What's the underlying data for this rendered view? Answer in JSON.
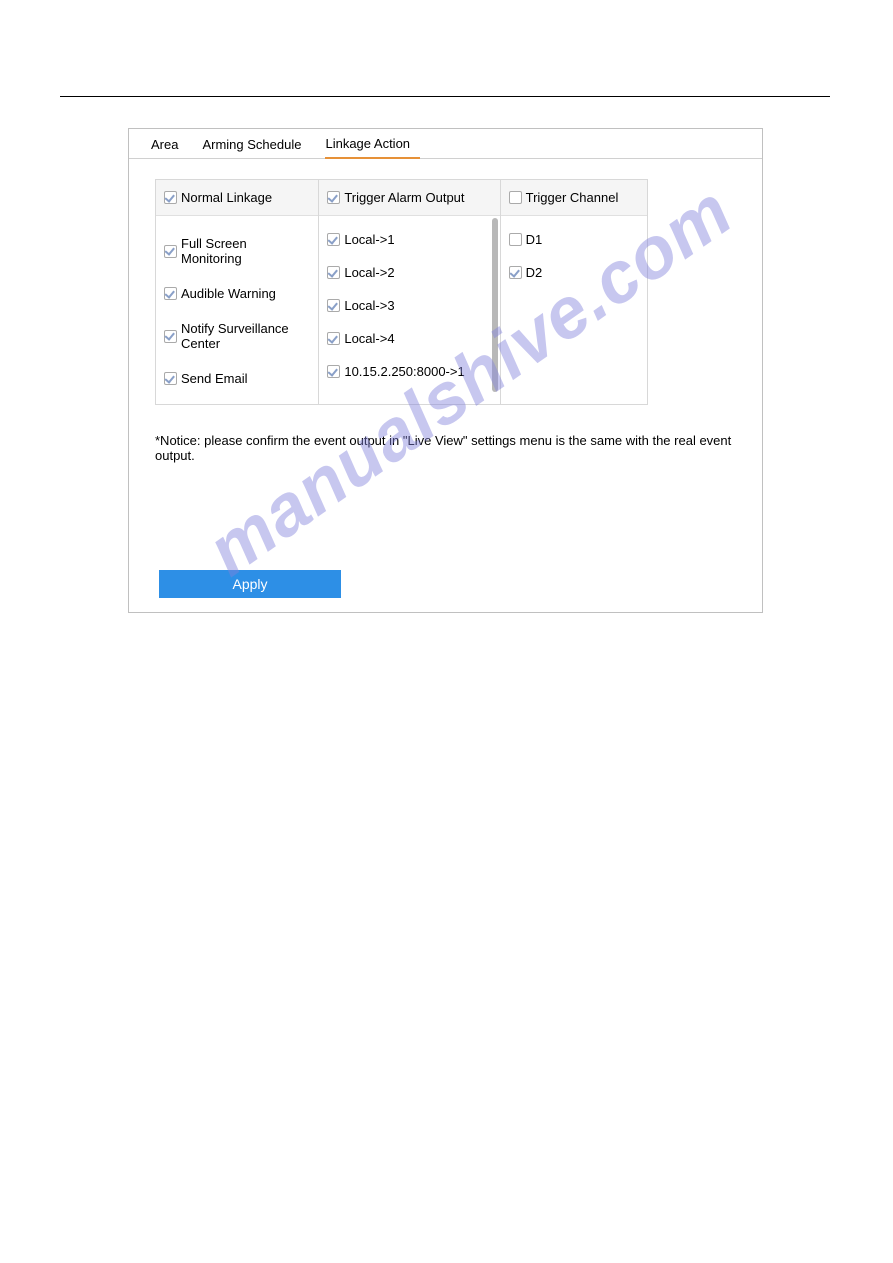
{
  "tabs": {
    "area": "Area",
    "arming_schedule": "Arming Schedule",
    "linkage_action": "Linkage Action"
  },
  "columns": {
    "normal_linkage": {
      "header": "Normal Linkage",
      "header_checked": true,
      "items": [
        {
          "label": "Full Screen Monitoring",
          "checked": true
        },
        {
          "label": "Audible Warning",
          "checked": true
        },
        {
          "label": "Notify Surveillance Center",
          "checked": true
        },
        {
          "label": "Send Email",
          "checked": true
        }
      ]
    },
    "trigger_alarm_output": {
      "header": "Trigger Alarm Output",
      "header_checked": true,
      "items": [
        {
          "label": "Local->1",
          "checked": true
        },
        {
          "label": "Local->2",
          "checked": true
        },
        {
          "label": "Local->3",
          "checked": true
        },
        {
          "label": "Local->4",
          "checked": true
        },
        {
          "label": "10.15.2.250:8000->1",
          "checked": true
        }
      ]
    },
    "trigger_channel": {
      "header": "Trigger Channel",
      "header_checked": false,
      "items": [
        {
          "label": "D1",
          "checked": false
        },
        {
          "label": "D2",
          "checked": true
        }
      ]
    }
  },
  "notice": "*Notice: please confirm the event output in \"Live View\" settings menu is the same with the real event output.",
  "apply_label": "Apply",
  "watermark": "manualshive.com"
}
